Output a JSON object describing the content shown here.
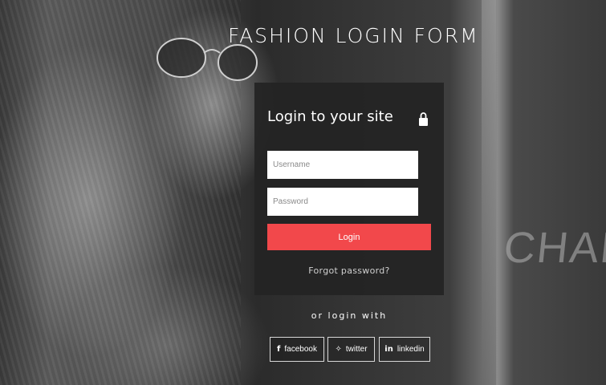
{
  "page": {
    "title": "FASHION LOGIN FORM",
    "background_sign": "CHANEL"
  },
  "login": {
    "heading": "Login to your site",
    "lock_icon": "lock-icon",
    "username_placeholder": "Username",
    "password_placeholder": "Password",
    "login_label": "Login",
    "forgot_label": "Forgot password?",
    "accent_color": "#f2484b"
  },
  "social": {
    "or_label": "or login with",
    "buttons": [
      {
        "icon": "facebook-icon",
        "glyph": "f",
        "label": "facebook"
      },
      {
        "icon": "twitter-icon",
        "glyph": "✧",
        "label": "twitter"
      },
      {
        "icon": "linkedin-icon",
        "glyph": "in",
        "label": "linkedin"
      }
    ]
  }
}
